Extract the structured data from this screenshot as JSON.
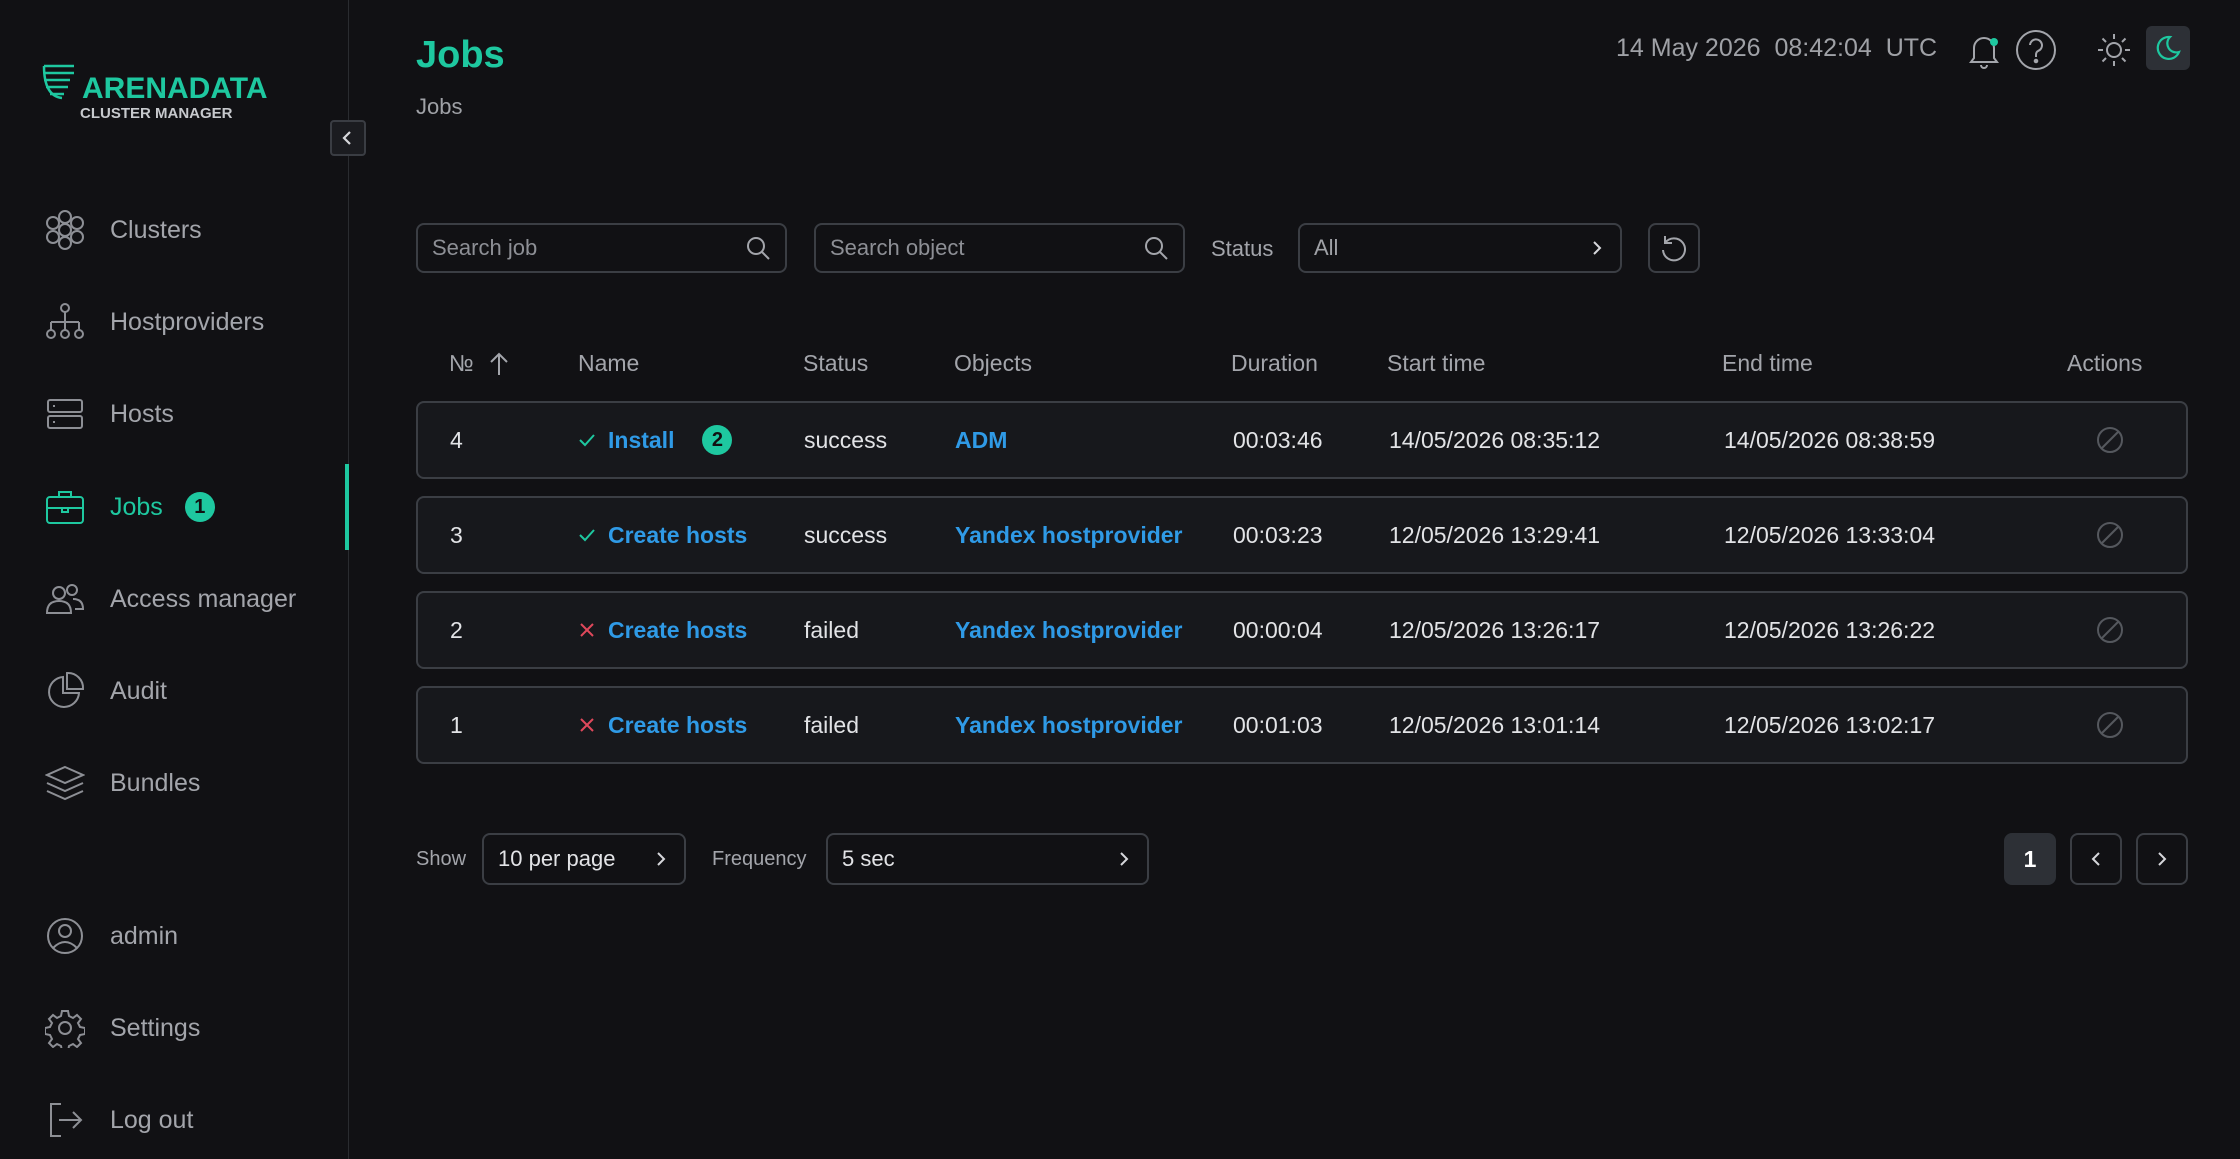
{
  "logo": {
    "brand": "ARENADATA",
    "product": "CLUSTER MANAGER"
  },
  "sidebar": {
    "items": [
      {
        "label": "Clusters",
        "icon": "clusters-icon"
      },
      {
        "label": "Hostproviders",
        "icon": "hostproviders-icon"
      },
      {
        "label": "Hosts",
        "icon": "hosts-icon"
      },
      {
        "label": "Jobs",
        "icon": "briefcase-icon",
        "badge": "1",
        "active": true
      },
      {
        "label": "Access manager",
        "icon": "users-icon"
      },
      {
        "label": "Audit",
        "icon": "audit-pie-icon"
      },
      {
        "label": "Bundles",
        "icon": "layers-icon"
      }
    ],
    "bottom": [
      {
        "label": "admin",
        "icon": "user-icon"
      },
      {
        "label": "Settings",
        "icon": "gear-icon"
      },
      {
        "label": "Log out",
        "icon": "logout-icon"
      }
    ]
  },
  "header": {
    "title": "Jobs",
    "breadcrumb": "Jobs",
    "date": "14 May 2026",
    "time": "08:42:04",
    "tz": "UTC"
  },
  "filters": {
    "search_job_placeholder": "Search job",
    "search_object_placeholder": "Search object",
    "status_label": "Status",
    "status_value": "All"
  },
  "table": {
    "columns": [
      "№",
      "Name",
      "Status",
      "Objects",
      "Duration",
      "Start time",
      "End time",
      "Actions"
    ],
    "rows": [
      {
        "id": "4",
        "name": "Install",
        "result": "ok",
        "badge": "2",
        "status": "success",
        "object": "ADM",
        "duration": "00:03:46",
        "start": "14/05/2026 08:35:12",
        "end": "14/05/2026 08:38:59"
      },
      {
        "id": "3",
        "name": "Create hosts",
        "result": "ok",
        "status": "success",
        "object": "Yandex hostprovider",
        "duration": "00:03:23",
        "start": "12/05/2026 13:29:41",
        "end": "12/05/2026 13:33:04"
      },
      {
        "id": "2",
        "name": "Create hosts",
        "result": "fail",
        "status": "failed",
        "object": "Yandex hostprovider",
        "duration": "00:00:04",
        "start": "12/05/2026 13:26:17",
        "end": "12/05/2026 13:26:22"
      },
      {
        "id": "1",
        "name": "Create hosts",
        "result": "fail",
        "status": "failed",
        "object": "Yandex hostprovider",
        "duration": "00:01:03",
        "start": "12/05/2026 13:01:14",
        "end": "12/05/2026 13:02:17"
      }
    ]
  },
  "footer": {
    "show_label": "Show",
    "per_page": "10 per page",
    "frequency_label": "Frequency",
    "frequency": "5 sec",
    "current_page": "1"
  },
  "colors": {
    "accent": "#1ec8a0",
    "link": "#2f9ae6",
    "fail": "#e0485b",
    "background": "#111114"
  }
}
